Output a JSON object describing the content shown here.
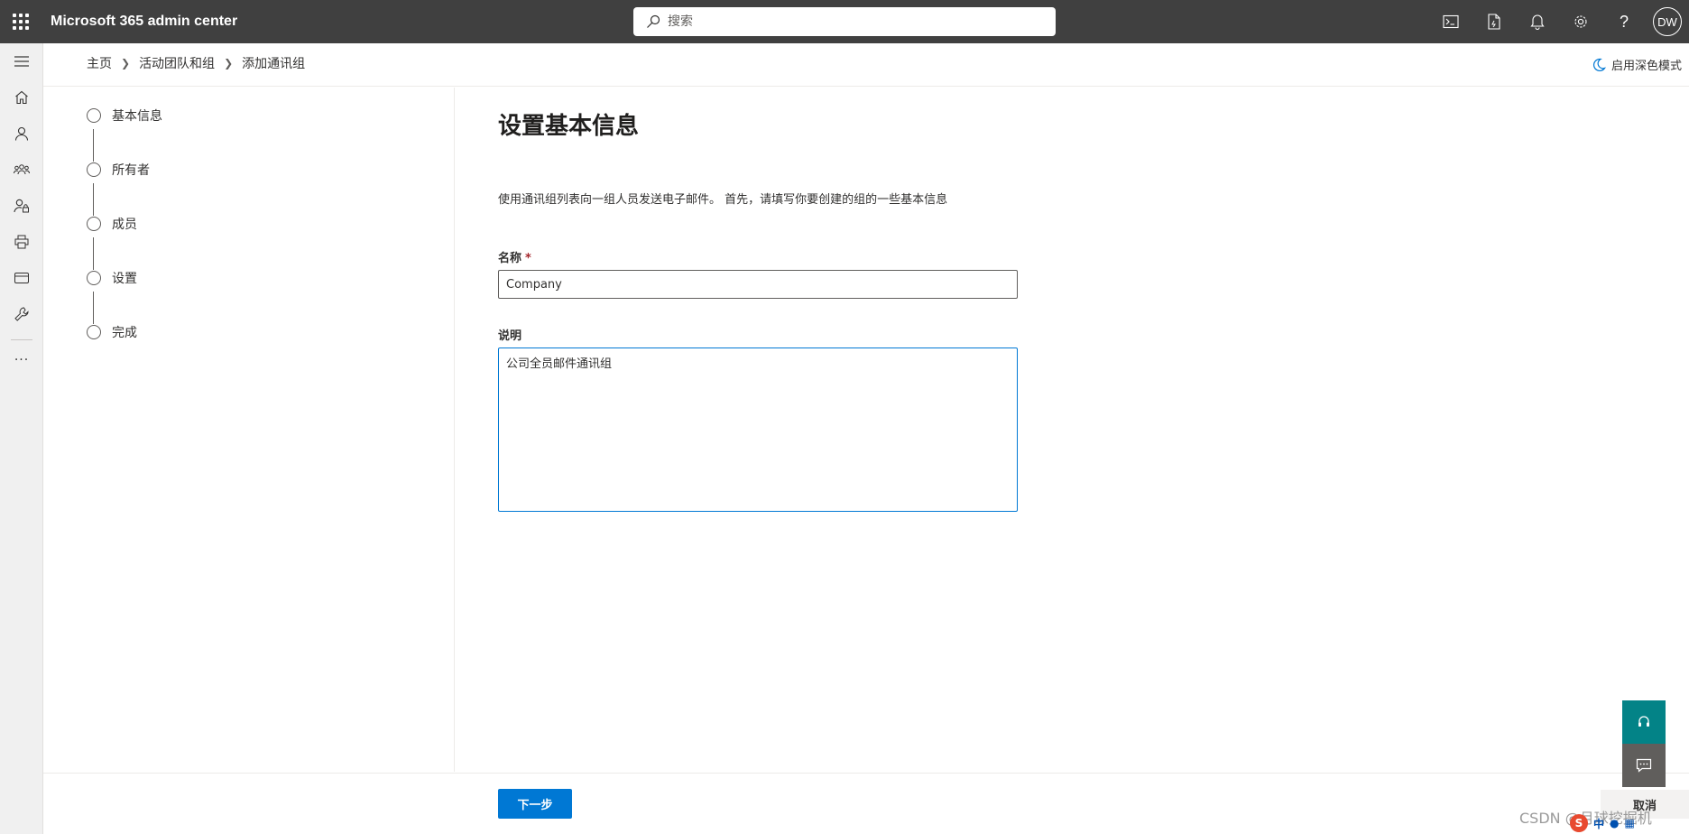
{
  "header": {
    "app_title": "Microsoft 365 admin center",
    "search_placeholder": "搜索",
    "avatar_initials": "DW",
    "icons": [
      "terminal-icon",
      "document-icon",
      "bell-icon",
      "gear-icon",
      "help-icon"
    ]
  },
  "left_rail": {
    "items": [
      "menu-icon",
      "home-icon",
      "user-icon",
      "team-icon",
      "user-lock-icon",
      "printer-icon",
      "billing-icon",
      "wrench-icon",
      "more-icon"
    ]
  },
  "breadcrumb": {
    "items": [
      "主页",
      "活动团队和组",
      "添加通讯组"
    ]
  },
  "dark_mode_label": "启用深色模式",
  "wizard": {
    "steps": [
      "基本信息",
      "所有者",
      "成员",
      "设置",
      "完成"
    ]
  },
  "form": {
    "title": "设置基本信息",
    "intro": "使用通讯组列表向一组人员发送电子邮件。 首先，请填写你要创建的组的一些基本信息",
    "name_label": "名称",
    "name_required_marker": "*",
    "name_value": "Company",
    "description_label": "说明",
    "description_value": "公司全员邮件通讯组"
  },
  "footer": {
    "next_label": "下一步",
    "cancel_label": "取消"
  },
  "overlay": {
    "watermark": "CSDN @月球挖掘机",
    "tray_badge": "S",
    "tray_text": "中"
  },
  "colors": {
    "topbar": "#404040",
    "accent": "#0078d4",
    "help_fab": "#038387",
    "feedback_fab": "#605e5c"
  }
}
